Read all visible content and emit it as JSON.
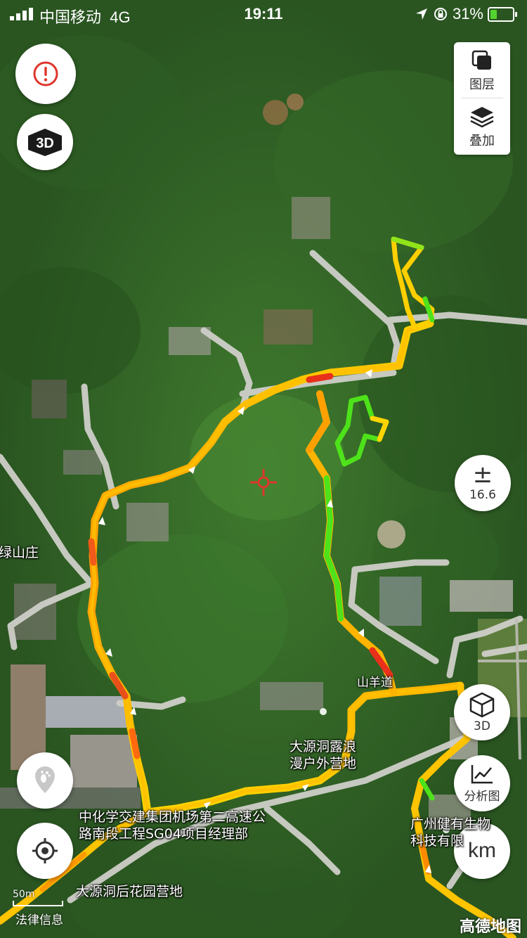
{
  "status_bar": {
    "carrier": "中国移动",
    "network": "4G",
    "time": "19:11",
    "battery": "31%",
    "battery_level": 0.31
  },
  "layers_panel": {
    "layers_label": "图层",
    "overlay_label": "叠加"
  },
  "controls": {
    "three_d_top_label": "3D",
    "zoom_symbol": "±",
    "zoom_level": "16.6",
    "three_d_label": "3D",
    "analysis_label": "分析图",
    "unit_label": "km"
  },
  "map_labels": {
    "shanzhuang": "绿山庄",
    "shanyang": "山羊道",
    "camp1_line1": "大源洞露浪",
    "camp1_line2": "漫户外营地",
    "project_line1": "中化学交建集团机场第二高速公",
    "project_line2": "路南段工程SG04项目经理部",
    "company_line1": "广州健有生物",
    "company_line2": "科技有限",
    "camp2": "大源洞后花园营地"
  },
  "scale": {
    "label": "50m"
  },
  "legal": "法律信息",
  "brand": "高德地图",
  "colors": {
    "track_fast": "#ffd400",
    "track_slow": "#e8301a",
    "track_green": "#4ee21a",
    "road": "#cfcfc9",
    "foliage_dark": "#27501f",
    "accent_red": "#e0352b"
  },
  "icons": [
    "signal-icon",
    "location-arrow-icon",
    "rotation-lock-icon",
    "battery-icon",
    "warning-icon",
    "cube-3d-icon",
    "layers-icon",
    "overlay-icon",
    "crosshair-icon",
    "cube-icon",
    "line-chart-icon",
    "footprint-icon",
    "locate-icon"
  ]
}
